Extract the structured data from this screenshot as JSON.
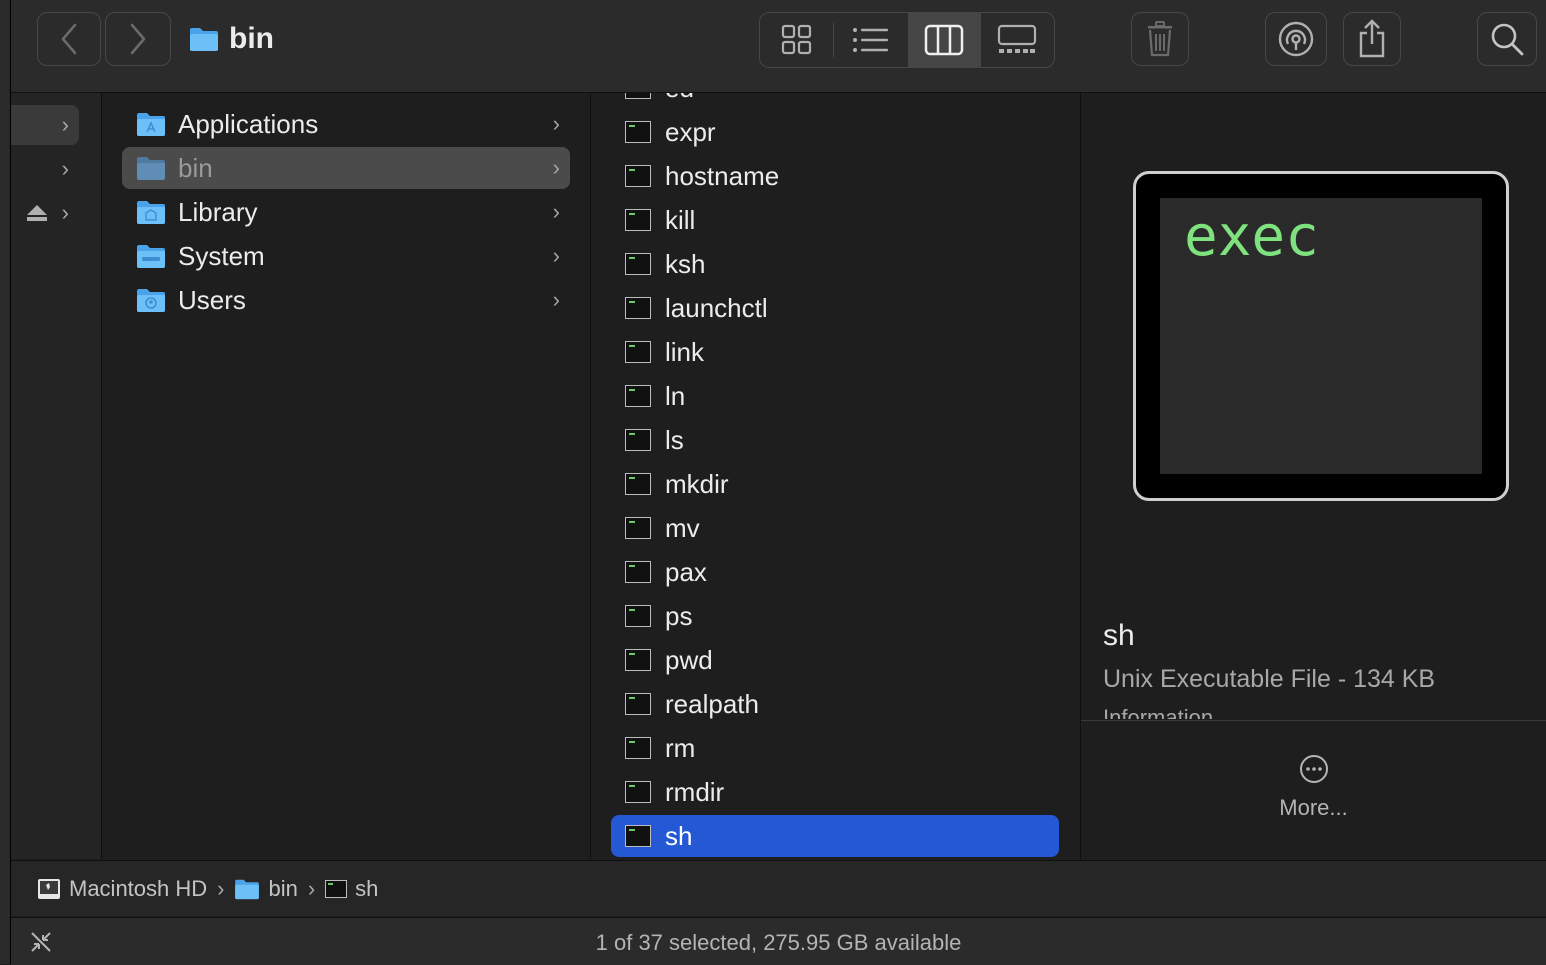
{
  "toolbar": {
    "title": "bin",
    "back_icon": "chevron-left-icon",
    "forward_icon": "chevron-right-icon",
    "views": [
      "icon-view-icon",
      "list-view-icon",
      "column-view-icon",
      "gallery-view-icon"
    ],
    "active_view": "column-view-icon"
  },
  "sidebar": {
    "rows": [
      {
        "icon": "chevron-right-icon",
        "active": true
      },
      {
        "icon": "chevron-right-icon",
        "active": false
      },
      {
        "icon": "eject-icon",
        "active": false
      }
    ]
  },
  "column1": {
    "items": [
      {
        "label": "Applications",
        "selected": false
      },
      {
        "label": "bin",
        "selected": true
      },
      {
        "label": "Library",
        "selected": false
      },
      {
        "label": "System",
        "selected": false
      },
      {
        "label": "Users",
        "selected": false
      }
    ]
  },
  "column2": {
    "items": [
      {
        "label": "ed"
      },
      {
        "label": "expr"
      },
      {
        "label": "hostname"
      },
      {
        "label": "kill"
      },
      {
        "label": "ksh"
      },
      {
        "label": "launchctl"
      },
      {
        "label": "link"
      },
      {
        "label": "ln"
      },
      {
        "label": "ls"
      },
      {
        "label": "mkdir"
      },
      {
        "label": "mv"
      },
      {
        "label": "pax"
      },
      {
        "label": "ps"
      },
      {
        "label": "pwd"
      },
      {
        "label": "realpath"
      },
      {
        "label": "rm"
      },
      {
        "label": "rmdir"
      },
      {
        "label": "sh",
        "selected": true
      }
    ]
  },
  "preview": {
    "thumbnail_text": "exec",
    "name": "sh",
    "kind": "Unix Executable File - 134 KB",
    "info_label": "Information",
    "more_label": "More..."
  },
  "pathbar": {
    "crumbs": [
      "Macintosh HD",
      "bin",
      "sh"
    ]
  },
  "status": {
    "text": "1 of 37 selected, 275.95 GB available"
  },
  "colors": {
    "selection": "#2458d4",
    "folder": "#5fb5f2",
    "exec_green": "#7ee27e"
  }
}
